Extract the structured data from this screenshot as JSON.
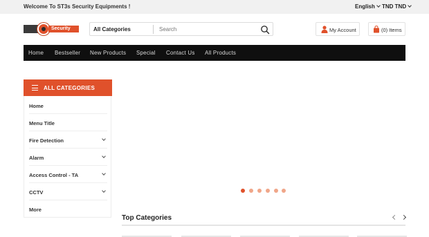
{
  "topbar": {
    "welcome": "Welcome To ST3s Security Equipments !",
    "language": "English",
    "currency": "TND TND"
  },
  "logo": {
    "text": "Security"
  },
  "search": {
    "category": "All Categories",
    "placeholder": "Search"
  },
  "account": {
    "label": "My Account"
  },
  "cart": {
    "label": "(0) Items"
  },
  "nav": {
    "items": [
      "Home",
      "Bestseller",
      "New Products",
      "Special",
      "Contact Us",
      "All Products"
    ]
  },
  "sidebar": {
    "title": "ALL CATEGORIES",
    "items": [
      {
        "label": "Home",
        "has_sub": false
      },
      {
        "label": "Menu Title",
        "has_sub": false
      },
      {
        "label": "Fire Detection",
        "has_sub": true
      },
      {
        "label": "Alarm",
        "has_sub": true
      },
      {
        "label": "Access Control - TA",
        "has_sub": true
      },
      {
        "label": "CCTV",
        "has_sub": true
      },
      {
        "label": "More",
        "has_sub": false
      }
    ]
  },
  "slider": {
    "dot_count": 6,
    "active_index": 0
  },
  "top_categories": {
    "title": "Top Categories"
  },
  "colors": {
    "accent": "#e0512b",
    "nav_bg": "#0f0f0f",
    "topbar_bg": "#f1f1f1"
  }
}
